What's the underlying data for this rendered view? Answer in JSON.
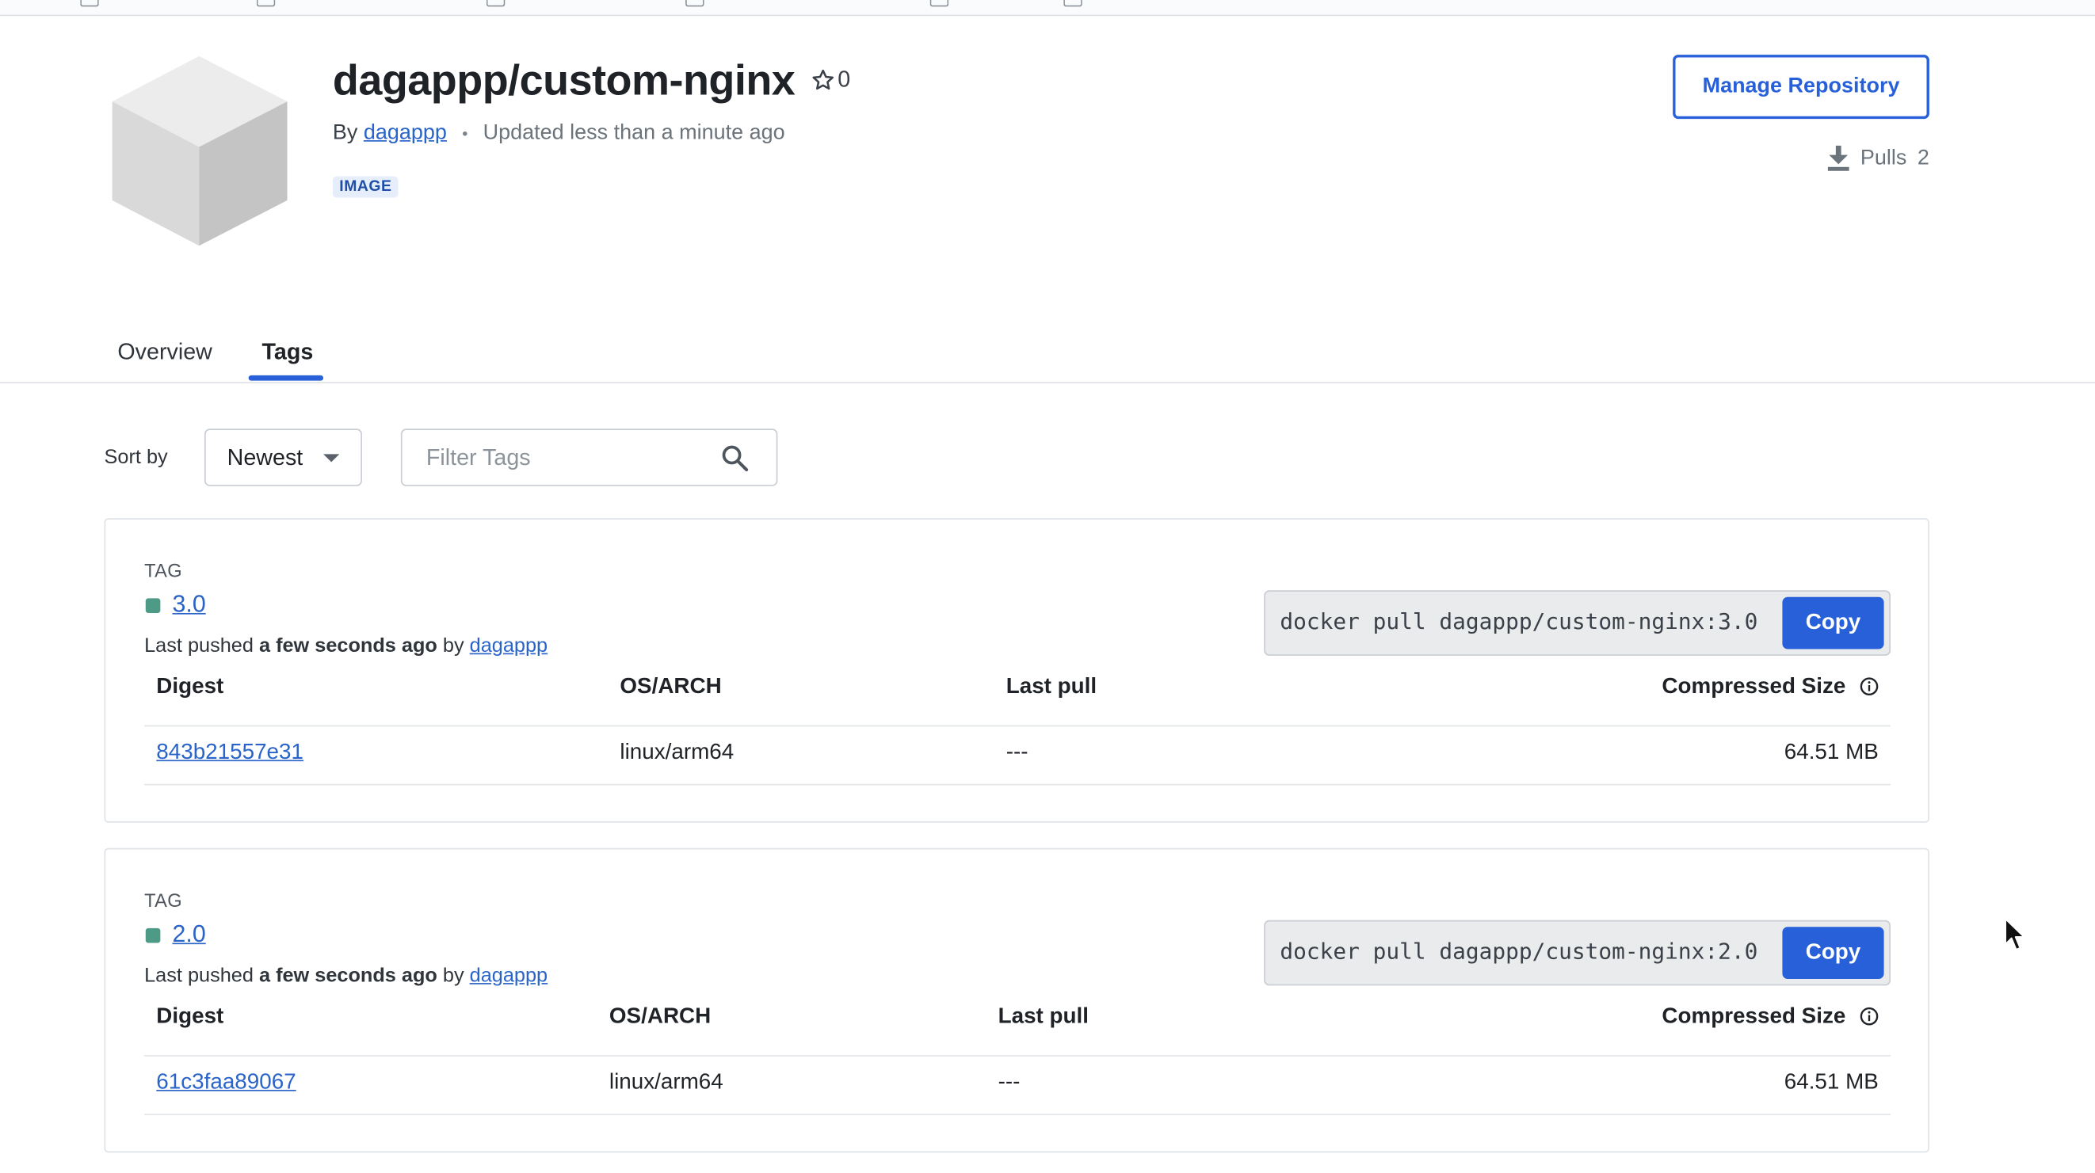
{
  "repo": {
    "title": "dagappp/custom-nginx",
    "stars": "0",
    "by_prefix": "By",
    "owner": "dagappp",
    "updated": "Updated less than a minute ago",
    "badge": "IMAGE",
    "manage_label": "Manage Repository",
    "pulls_label": "Pulls",
    "pulls_count": "2"
  },
  "tabs": [
    {
      "label": "Overview",
      "active": false
    },
    {
      "label": "Tags",
      "active": true
    }
  ],
  "filters": {
    "sort_label": "Sort by",
    "sort_value": "Newest",
    "filter_placeholder": "Filter Tags"
  },
  "tags": [
    {
      "tag_heading": "TAG",
      "name": "3.0",
      "pushed_prefix": "Last pushed",
      "pushed_when": "a few seconds ago",
      "pushed_by_prefix": "by",
      "pushed_by": "dagappp",
      "command": "docker pull dagappp/custom-nginx:3.0",
      "copy_label": "Copy",
      "headers": {
        "digest": "Digest",
        "osarch": "OS/ARCH",
        "last_pull": "Last pull",
        "size": "Compressed Size"
      },
      "row": {
        "digest": "843b21557e31",
        "osarch": "linux/arm64",
        "last_pull": "---",
        "size": "64.51 MB"
      }
    },
    {
      "tag_heading": "TAG",
      "name": "2.0",
      "pushed_prefix": "Last pushed",
      "pushed_when": "a few seconds ago",
      "pushed_by_prefix": "by",
      "pushed_by": "dagappp",
      "command": "docker pull dagappp/custom-nginx:2.0",
      "copy_label": "Copy",
      "headers": {
        "digest": "Digest",
        "osarch": "OS/ARCH",
        "last_pull": "Last pull",
        "size": "Compressed Size"
      },
      "row": {
        "digest": "61c3faa89067",
        "osarch": "linux/arm64",
        "last_pull": "---",
        "size": "64.51 MB"
      }
    }
  ],
  "colors": {
    "accent": "#2760d9",
    "link": "#2a64c9",
    "tag_status": "#4d9a86",
    "badge_bg": "#e6eefb"
  },
  "icons": [
    "star-icon",
    "download-icon",
    "search-icon",
    "chevron-down-icon",
    "info-icon",
    "cube-icon",
    "mouse-cursor-icon"
  ]
}
